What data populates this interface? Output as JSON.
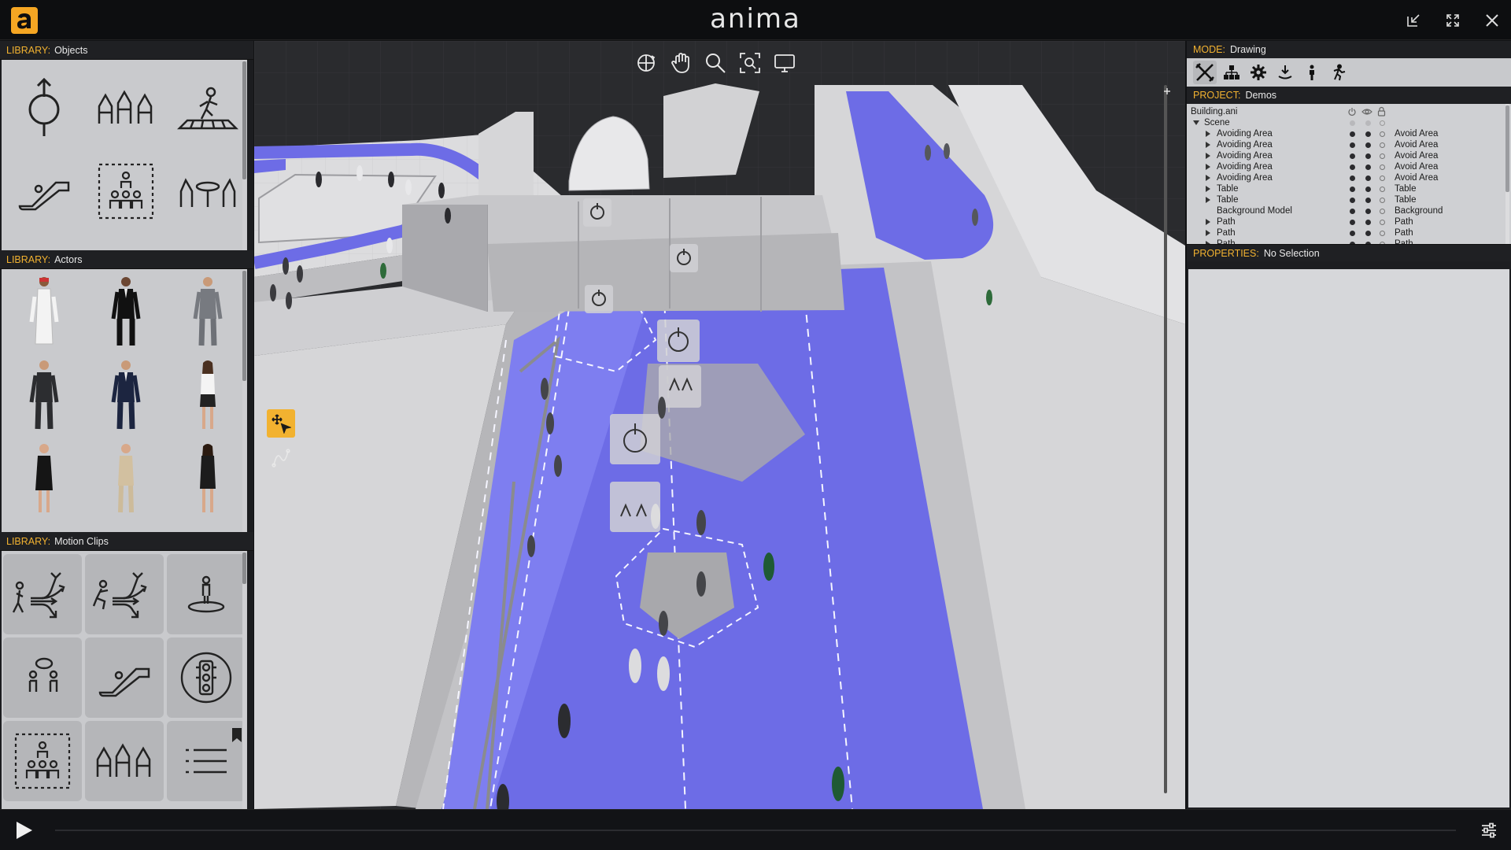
{
  "app": {
    "title": "anima"
  },
  "libraries": {
    "objects": {
      "key": "LIBRARY:",
      "name": "Objects"
    },
    "actors": {
      "key": "LIBRARY:",
      "name": "Actors"
    },
    "motion_clips": {
      "key": "LIBRARY:",
      "name": "Motion Clips"
    }
  },
  "mode": {
    "key": "MODE:",
    "value": "Drawing"
  },
  "project": {
    "key": "PROJECT:",
    "value": "Demos"
  },
  "properties": {
    "key": "PROPERTIES:",
    "value": "No Selection"
  },
  "tree": {
    "file": "Building.ani",
    "scene": "Scene",
    "items": [
      {
        "name": "Avoiding Area",
        "type": "Avoid Area"
      },
      {
        "name": "Avoiding Area",
        "type": "Avoid Area"
      },
      {
        "name": "Avoiding Area",
        "type": "Avoid Area"
      },
      {
        "name": "Avoiding Area",
        "type": "Avoid Area"
      },
      {
        "name": "Avoiding Area",
        "type": "Avoid Area"
      },
      {
        "name": "Table",
        "type": "Table"
      },
      {
        "name": "Table",
        "type": "Table"
      },
      {
        "name": "Background Model",
        "type": "Background"
      },
      {
        "name": "Path",
        "type": "Path"
      },
      {
        "name": "Path",
        "type": "Path"
      },
      {
        "name": "Path",
        "type": "Path"
      }
    ]
  },
  "colors": {
    "accent": "#f2b230",
    "path_blue": "#6d6ce6",
    "panel_bg": "#c9cacd"
  }
}
